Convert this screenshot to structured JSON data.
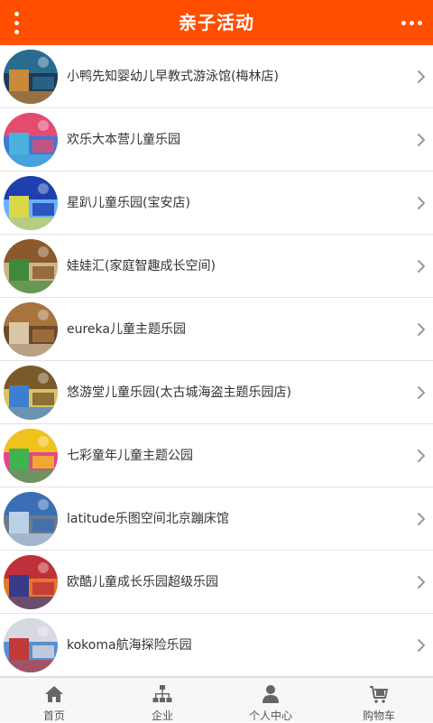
{
  "header": {
    "title": "亲子活动",
    "menu_icon": "vertical-dots-icon",
    "more_icon": "horizontal-dots-icon"
  },
  "items": [
    {
      "label": "小鸭先知婴幼儿早教式游泳馆(梅林店)",
      "colors": [
        "#2a6c8f",
        "#c98a3a",
        "#1d3a58"
      ]
    },
    {
      "label": "欢乐大本营儿童乐园",
      "colors": [
        "#e54b6f",
        "#4bb2e0",
        "#3a7bd5"
      ]
    },
    {
      "label": "星趴儿童乐园(宝安店)",
      "colors": [
        "#1e3fae",
        "#d8d84a",
        "#6ab0ff"
      ]
    },
    {
      "label": "娃娃汇(家庭智趣成长空间)",
      "colors": [
        "#8a5a2c",
        "#3e8a3a",
        "#c9b48c"
      ]
    },
    {
      "label": "eureka儿童主题乐园",
      "colors": [
        "#a8743e",
        "#d9c7a8",
        "#6b4a2c"
      ]
    },
    {
      "label": "悠游堂儿童乐园(太古城海盗主题乐园店)",
      "colors": [
        "#7a5a2a",
        "#3c7fd0",
        "#d8c26a"
      ]
    },
    {
      "label": "七彩童年儿童主题公园",
      "colors": [
        "#f0c21b",
        "#3fb34f",
        "#e2468a"
      ]
    },
    {
      "label": "latitude乐图空间北京蹦床馆",
      "colors": [
        "#3a6fb5",
        "#bcd0e8",
        "#6a7b8c"
      ]
    },
    {
      "label": "欧酷儿童成长乐园超级乐园",
      "colors": [
        "#c0303a",
        "#3a3a8a",
        "#e07a2a"
      ]
    },
    {
      "label": "kokoma航海探险乐园",
      "colors": [
        "#d8d8e0",
        "#c03a3a",
        "#5a8fd0"
      ]
    }
  ],
  "tabs": [
    {
      "label": "首页",
      "icon": "home-icon"
    },
    {
      "label": "企业",
      "icon": "org-chart-icon"
    },
    {
      "label": "个人中心",
      "icon": "user-icon"
    },
    {
      "label": "购物车",
      "icon": "cart-icon"
    }
  ]
}
